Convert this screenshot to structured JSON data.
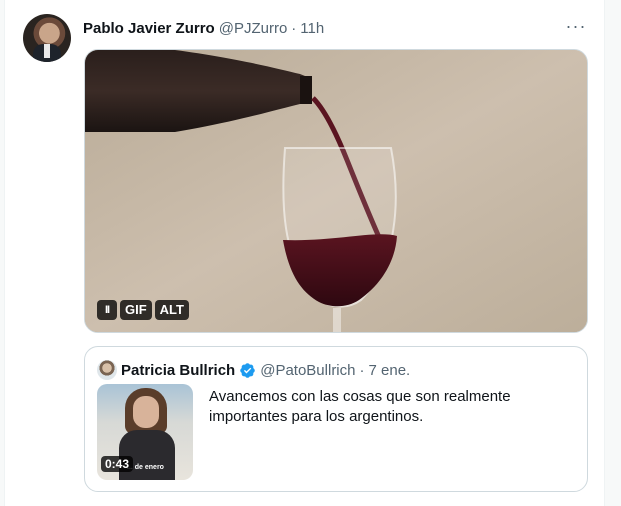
{
  "tweet": {
    "author_name": "Pablo Javier Zurro",
    "author_handle": "@PJZurro",
    "separator": "·",
    "time": "11h",
    "more_glyph": "···",
    "media": {
      "badges": [
        "GIF",
        "ALT"
      ],
      "pause_glyph": "II"
    }
  },
  "quoted": {
    "author_name": "Patricia Bullrich",
    "author_handle": "@PatoBullrich",
    "separator": "·",
    "time": "7 ene.",
    "text": "Avancemos con las cosas que son realmente importantes para los argentinos.",
    "video_duration": "0:43",
    "thumb_caption": "... de enero"
  },
  "colors": {
    "accent": "#1d9bf0",
    "text_secondary": "#536471",
    "border": "#cfd9de"
  },
  "icons": {
    "more": "more-horizontal-icon",
    "verified": "verified-badge-icon",
    "pause": "pause-icon"
  }
}
